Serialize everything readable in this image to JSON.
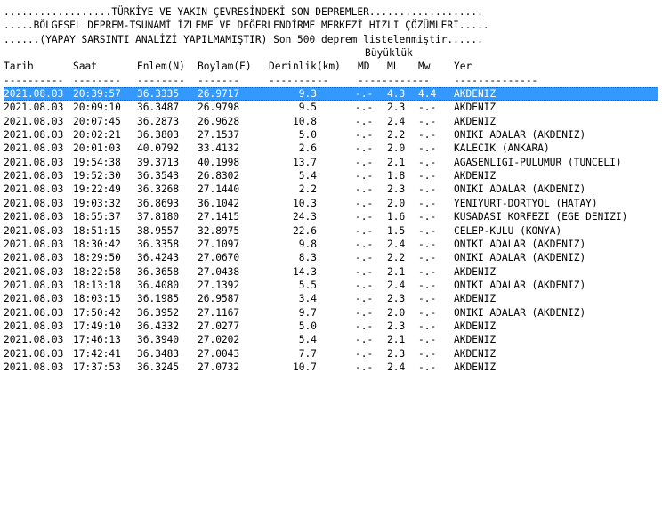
{
  "header": {
    "line1": "..................TÜRKİYE VE YAKIN ÇEVRESİNDEKİ SON DEPREMLER...................",
    "line2": ".....BÖLGESEL DEPREM-TSUNAMİ İZLEME VE DEĞERLENDİRME MERKEZİ HIZLI ÇÖZÜMLERİ.....",
    "line3": "......(YAPAY SARSINTI ANALİZİ YAPILMAMIŞTIR) Son 500 deprem listelenmiştir......",
    "magnitude_group_label": "Büyüklük"
  },
  "columns": {
    "date": "Tarih",
    "time": "Saat",
    "lat": "Enlem(N)",
    "lon": "Boylam(E)",
    "depth": "Derinlik(km)",
    "md": "MD",
    "ml": "ML",
    "mw": "Mw",
    "place": "Yer"
  },
  "rules": {
    "date": "----------",
    "time": "--------",
    "lat": "--------",
    "lon": "-------",
    "depth": "----------",
    "md": "------------",
    "place": "--------------"
  },
  "selected_index": 0,
  "rows": [
    {
      "date": "2021.08.03",
      "time": "20:39:57",
      "lat": "36.3335",
      "lon": "26.9717",
      "depth": "9.3",
      "md": "-.-",
      "ml": "4.3",
      "mw": "4.4",
      "place": "AKDENIZ"
    },
    {
      "date": "2021.08.03",
      "time": "20:09:10",
      "lat": "36.3487",
      "lon": "26.9798",
      "depth": "9.5",
      "md": "-.-",
      "ml": "2.3",
      "mw": "-.-",
      "place": "AKDENIZ"
    },
    {
      "date": "2021.08.03",
      "time": "20:07:45",
      "lat": "36.2873",
      "lon": "26.9628",
      "depth": "10.8",
      "md": "-.-",
      "ml": "2.4",
      "mw": "-.-",
      "place": "AKDENIZ"
    },
    {
      "date": "2021.08.03",
      "time": "20:02:21",
      "lat": "36.3803",
      "lon": "27.1537",
      "depth": "5.0",
      "md": "-.-",
      "ml": "2.2",
      "mw": "-.-",
      "place": "ONIKI ADALAR (AKDENIZ)"
    },
    {
      "date": "2021.08.03",
      "time": "20:01:03",
      "lat": "40.0792",
      "lon": "33.4132",
      "depth": "2.6",
      "md": "-.-",
      "ml": "2.0",
      "mw": "-.-",
      "place": "KALECIK (ANKARA)"
    },
    {
      "date": "2021.08.03",
      "time": "19:54:38",
      "lat": "39.3713",
      "lon": "40.1998",
      "depth": "13.7",
      "md": "-.-",
      "ml": "2.1",
      "mw": "-.-",
      "place": "AGASENLIGI-PULUMUR (TUNCELI)"
    },
    {
      "date": "2021.08.03",
      "time": "19:52:30",
      "lat": "36.3543",
      "lon": "26.8302",
      "depth": "5.4",
      "md": "-.-",
      "ml": "1.8",
      "mw": "-.-",
      "place": "AKDENIZ"
    },
    {
      "date": "2021.08.03",
      "time": "19:22:49",
      "lat": "36.3268",
      "lon": "27.1440",
      "depth": "2.2",
      "md": "-.-",
      "ml": "2.3",
      "mw": "-.-",
      "place": "ONIKI ADALAR (AKDENIZ)"
    },
    {
      "date": "2021.08.03",
      "time": "19:03:32",
      "lat": "36.8693",
      "lon": "36.1042",
      "depth": "10.3",
      "md": "-.-",
      "ml": "2.0",
      "mw": "-.-",
      "place": "YENIYURT-DORTYOL (HATAY)"
    },
    {
      "date": "2021.08.03",
      "time": "18:55:37",
      "lat": "37.8180",
      "lon": "27.1415",
      "depth": "24.3",
      "md": "-.-",
      "ml": "1.6",
      "mw": "-.-",
      "place": "KUSADASI KORFEZI (EGE DENIZI)"
    },
    {
      "date": "2021.08.03",
      "time": "18:51:15",
      "lat": "38.9557",
      "lon": "32.8975",
      "depth": "22.6",
      "md": "-.-",
      "ml": "1.5",
      "mw": "-.-",
      "place": "CELEP-KULU (KONYA)"
    },
    {
      "date": "2021.08.03",
      "time": "18:30:42",
      "lat": "36.3358",
      "lon": "27.1097",
      "depth": "9.8",
      "md": "-.-",
      "ml": "2.4",
      "mw": "-.-",
      "place": "ONIKI ADALAR (AKDENIZ)"
    },
    {
      "date": "2021.08.03",
      "time": "18:29:50",
      "lat": "36.4243",
      "lon": "27.0670",
      "depth": "8.3",
      "md": "-.-",
      "ml": "2.2",
      "mw": "-.-",
      "place": "ONIKI ADALAR (AKDENIZ)"
    },
    {
      "date": "2021.08.03",
      "time": "18:22:58",
      "lat": "36.3658",
      "lon": "27.0438",
      "depth": "14.3",
      "md": "-.-",
      "ml": "2.1",
      "mw": "-.-",
      "place": "AKDENIZ"
    },
    {
      "date": "2021.08.03",
      "time": "18:13:18",
      "lat": "36.4080",
      "lon": "27.1392",
      "depth": "5.5",
      "md": "-.-",
      "ml": "2.4",
      "mw": "-.-",
      "place": "ONIKI ADALAR (AKDENIZ)"
    },
    {
      "date": "2021.08.03",
      "time": "18:03:15",
      "lat": "36.1985",
      "lon": "26.9587",
      "depth": "3.4",
      "md": "-.-",
      "ml": "2.3",
      "mw": "-.-",
      "place": "AKDENIZ"
    },
    {
      "date": "2021.08.03",
      "time": "17:50:42",
      "lat": "36.3952",
      "lon": "27.1167",
      "depth": "9.7",
      "md": "-.-",
      "ml": "2.0",
      "mw": "-.-",
      "place": "ONIKI ADALAR (AKDENIZ)"
    },
    {
      "date": "2021.08.03",
      "time": "17:49:10",
      "lat": "36.4332",
      "lon": "27.0277",
      "depth": "5.0",
      "md": "-.-",
      "ml": "2.3",
      "mw": "-.-",
      "place": "AKDENIZ"
    },
    {
      "date": "2021.08.03",
      "time": "17:46:13",
      "lat": "36.3940",
      "lon": "27.0202",
      "depth": "5.4",
      "md": "-.-",
      "ml": "2.1",
      "mw": "-.-",
      "place": "AKDENIZ"
    },
    {
      "date": "2021.08.03",
      "time": "17:42:41",
      "lat": "36.3483",
      "lon": "27.0043",
      "depth": "7.7",
      "md": "-.-",
      "ml": "2.3",
      "mw": "-.-",
      "place": "AKDENIZ"
    },
    {
      "date": "2021.08.03",
      "time": "17:37:53",
      "lat": "36.3245",
      "lon": "27.0732",
      "depth": "10.7",
      "md": "-.-",
      "ml": "2.4",
      "mw": "-.-",
      "place": "AKDENIZ"
    }
  ]
}
